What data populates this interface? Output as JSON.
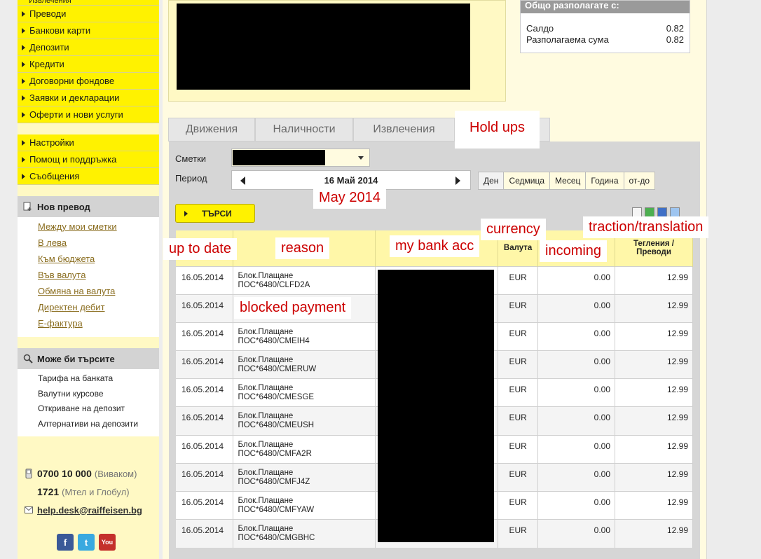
{
  "sidebar": {
    "top_cut": "Извлечения",
    "menu1": [
      "Преводи",
      "Банкови карти",
      "Депозити",
      "Кредити",
      "Договорни фондове",
      "Заявки и декларации",
      "Оферти и нови услуги"
    ],
    "menu2": [
      "Настройки",
      "Помощ и поддръжка",
      "Съобщения"
    ],
    "transfer": {
      "title": "Нов превод",
      "links": [
        "Между мои сметки",
        "В лева",
        "Към бюджета",
        "Във валута",
        "Обмяна на валута",
        "Директен дебит",
        "Е-фактура"
      ]
    },
    "maybe": {
      "title": "Може би търсите",
      "items": [
        "Тарифа на банката",
        "Валутни курсове",
        "Откриване на депозит",
        "Алтернативи на депозити"
      ]
    },
    "contact": {
      "phone1": "0700 10 000",
      "phone1_note": "(Виваком)",
      "phone2": "1721",
      "phone2_note": "(Мтел и Глобул)",
      "email": "help.desk@raiffeisen.bg"
    },
    "social": [
      {
        "icon": "facebook-icon",
        "label": "f",
        "color": "#3b5998"
      },
      {
        "icon": "twitter-icon",
        "label": "t",
        "color": "#39a9e0"
      },
      {
        "icon": "youtube-icon",
        "label": "You",
        "color": "#c4302b"
      }
    ]
  },
  "summary": {
    "title": "Общо разполагате с:",
    "rows": [
      {
        "label": "Салдо",
        "value": "0.82"
      },
      {
        "label": "Разполагаема сума",
        "value": "0.82"
      }
    ]
  },
  "tabs": [
    "Движения",
    "Наличности",
    "Извлечения",
    "Hold ups"
  ],
  "filters": {
    "accounts_label": "Сметки",
    "period_label": "Период",
    "period_value": "16 Май 2014",
    "ranges": [
      "Ден",
      "Седмица",
      "Месец",
      "Година",
      "от-до"
    ],
    "search_button": "ТЪРСИ"
  },
  "annotations": {
    "may": "May 2014",
    "currency": "currency",
    "traction": "traction/translation",
    "up_to_date": "up to date",
    "reason": "reason",
    "bank_acc": "my bank acc",
    "incoming": "incoming",
    "blocked": "blocked payment"
  },
  "table": {
    "headers": [
      "",
      "",
      "",
      "Валута",
      "",
      "Тегления / Преводи"
    ],
    "rows": [
      {
        "date": "16.05.2014",
        "r1": "Блок.Плащане",
        "r2": "ПОС*6480/CLFD2A",
        "cur": "EUR",
        "in": "0.00",
        "out": "12.99"
      },
      {
        "date": "16.05.2014",
        "r1": "",
        "r2": "",
        "cur": "EUR",
        "in": "0.00",
        "out": "12.99"
      },
      {
        "date": "16.05.2014",
        "r1": "Блок.Плащане",
        "r2": "ПОС*6480/CMEIH4",
        "cur": "EUR",
        "in": "0.00",
        "out": "12.99"
      },
      {
        "date": "16.05.2014",
        "r1": "Блок.Плащане",
        "r2": "ПОС*6480/CMERUW",
        "cur": "EUR",
        "in": "0.00",
        "out": "12.99"
      },
      {
        "date": "16.05.2014",
        "r1": "Блок.Плащане",
        "r2": "ПОС*6480/CMESGE",
        "cur": "EUR",
        "in": "0.00",
        "out": "12.99"
      },
      {
        "date": "16.05.2014",
        "r1": "Блок.Плащане",
        "r2": "ПОС*6480/CMEUSH",
        "cur": "EUR",
        "in": "0.00",
        "out": "12.99"
      },
      {
        "date": "16.05.2014",
        "r1": "Блок.Плащане",
        "r2": "ПОС*6480/CMFA2R",
        "cur": "EUR",
        "in": "0.00",
        "out": "12.99"
      },
      {
        "date": "16.05.2014",
        "r1": "Блок.Плащане",
        "r2": "ПОС*6480/CMFJ4Z",
        "cur": "EUR",
        "in": "0.00",
        "out": "12.99"
      },
      {
        "date": "16.05.2014",
        "r1": "Блок.Плащане",
        "r2": "ПОС*6480/CMFYAW",
        "cur": "EUR",
        "in": "0.00",
        "out": "12.99"
      },
      {
        "date": "16.05.2014",
        "r1": "Блок.Плащане",
        "r2": "ПОС*6480/CMGBHC",
        "cur": "EUR",
        "in": "0.00",
        "out": "12.99"
      }
    ]
  }
}
